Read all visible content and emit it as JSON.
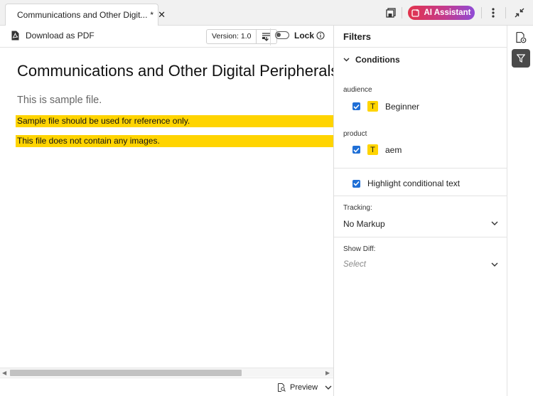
{
  "tab": {
    "title": "Communications and Other Digit...",
    "modified": "*",
    "close": "✕"
  },
  "topbar": {
    "ai_label": "AI Assistant"
  },
  "toolbar": {
    "download_label": "Download as PDF",
    "version_label": "Version: 1.0",
    "lock_label": "Lock",
    "lock_on": false
  },
  "document": {
    "heading": "Communications and Other Digital Peripherals",
    "para": "This is sample file.",
    "highlight1": "Sample file should be used for reference only.",
    "highlight2": "This file does not contain any images."
  },
  "status": {
    "preview_label": "Preview"
  },
  "filters": {
    "title": "Filters",
    "conditions_label": "Conditions",
    "groups": [
      {
        "label": "audience",
        "item": "Beginner",
        "checked": true
      },
      {
        "label": "product",
        "item": "aem",
        "checked": true
      }
    ],
    "highlight_label": "Highlight conditional text",
    "tracking_label": "Tracking:",
    "tracking_value": "No Markup",
    "diff_label": "Show Diff:",
    "diff_placeholder": "Select"
  },
  "colors": {
    "accent": "#1f6fd6",
    "highlight": "#ffd400",
    "ai_gradient_start": "#e2334b",
    "ai_gradient_end": "#8f4bd6"
  }
}
